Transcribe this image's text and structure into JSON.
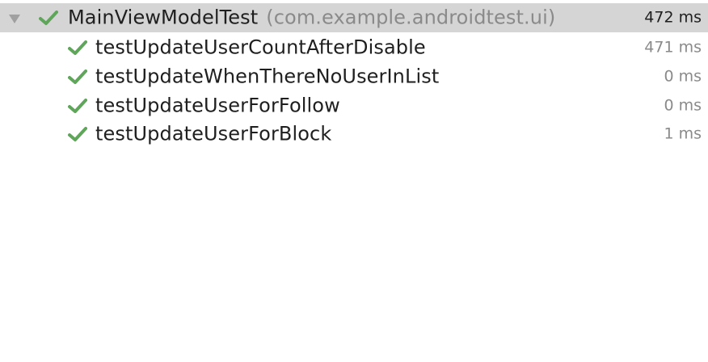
{
  "suite": {
    "name": "MainViewModelTest",
    "package": "(com.example.androidtest.ui)",
    "duration": "472 ms",
    "status": "passed"
  },
  "tests": [
    {
      "name": "testUpdateUserCountAfterDisable",
      "duration": "471 ms",
      "status": "passed"
    },
    {
      "name": "testUpdateWhenThereNoUserInList",
      "duration": "0 ms",
      "status": "passed"
    },
    {
      "name": "testUpdateUserForFollow",
      "duration": "0 ms",
      "status": "passed"
    },
    {
      "name": "testUpdateUserForBlock",
      "duration": "1 ms",
      "status": "passed"
    }
  ],
  "icons": {
    "expand": "triangle-down-icon",
    "pass": "check-icon"
  },
  "colors": {
    "selection_bg": "#d5d5d5",
    "pass_green": "#5fa55a",
    "toggle_gray": "#a0a0a0",
    "secondary_text": "#8a8a8a"
  }
}
